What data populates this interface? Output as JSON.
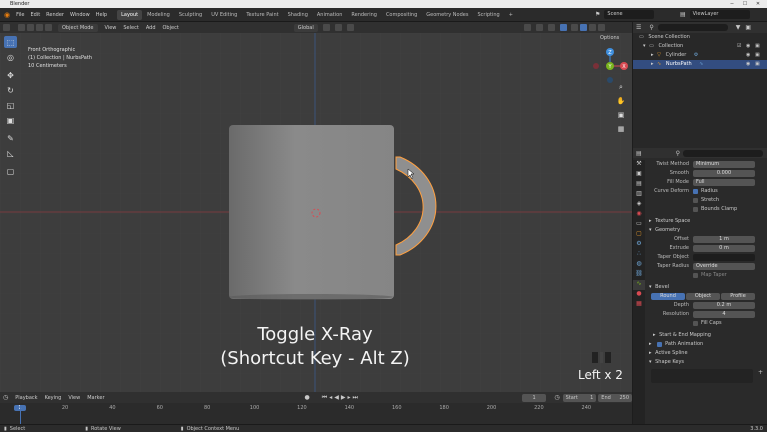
{
  "window": {
    "title": "Blender",
    "minimize": "─",
    "maximize": "☐",
    "close": "✕"
  },
  "menus": [
    "File",
    "Edit",
    "Render",
    "Window",
    "Help"
  ],
  "workspaces": [
    "Layout",
    "Modeling",
    "Sculpting",
    "UV Editing",
    "Texture Paint",
    "Shading",
    "Animation",
    "Rendering",
    "Compositing",
    "Geometry Nodes",
    "Scripting",
    "+"
  ],
  "active_workspace": "Layout",
  "scene": {
    "name": "Scene",
    "view_layer": "ViewLayer"
  },
  "viewport_header": {
    "mode": "Object Mode",
    "menus": [
      "View",
      "Select",
      "Add",
      "Object"
    ],
    "orientation": "Global",
    "options": "Options"
  },
  "viewport_info": {
    "line1": "Front Orthographic",
    "line2": "(1) Collection | NurbsPath",
    "line3": "10 Centimeters"
  },
  "gizmo": {
    "x": "X",
    "y": "Y",
    "z": "Z"
  },
  "overlay_caption": {
    "line1": "Toggle X-Ray",
    "line2": "(Shortcut Key - Alt Z)"
  },
  "key_hint": "Left x 2",
  "outliner": {
    "search_placeholder": "",
    "items": [
      {
        "label": "Scene Collection",
        "indent": 0
      },
      {
        "label": "Collection",
        "indent": 1
      },
      {
        "label": "Cylinder",
        "indent": 2
      },
      {
        "label": "NurbsPath",
        "indent": 2,
        "selected": true
      }
    ]
  },
  "properties": {
    "twist_method_label": "Twist Method",
    "twist_method_value": "Minimum",
    "smooth_label": "Smooth",
    "smooth_value": "0.000",
    "fill_mode_label": "Fill Mode",
    "fill_mode_value": "Full",
    "curve_deform_label": "Curve Deform",
    "radius_label": "Radius",
    "stretch_label": "Stretch",
    "bounds_clamp_label": "Bounds Clamp",
    "texture_space": "Texture Space",
    "geometry": "Geometry",
    "offset_label": "Offset",
    "offset_value": "1 m",
    "extrude_label": "Extrude",
    "extrude_value": "0 m",
    "taper_object_label": "Taper Object",
    "taper_radius_label": "Taper Radius",
    "taper_radius_value": "Override",
    "map_taper_label": "Map Taper",
    "bevel": "Bevel",
    "bevel_tabs": [
      "Round",
      "Object",
      "Profile"
    ],
    "depth_label": "Depth",
    "depth_value": "0.2 m",
    "resolution_label": "Resolution",
    "resolution_value": "4",
    "fill_caps_label": "Fill Caps",
    "start_end_mapping": "Start & End Mapping",
    "path_animation": "Path Animation",
    "active_spline": "Active Spline",
    "shape_keys": "Shape Keys"
  },
  "timeline": {
    "menus": [
      "Playback",
      "Keying",
      "View",
      "Marker"
    ],
    "current_frame": "1",
    "start_label": "Start",
    "start_value": "1",
    "end_label": "End",
    "end_value": "250",
    "ticks": [
      "1",
      "10",
      "20",
      "30",
      "40",
      "50",
      "60",
      "70",
      "80",
      "90",
      "100",
      "110",
      "120",
      "130",
      "140",
      "150",
      "160",
      "170",
      "180",
      "190",
      "200",
      "210",
      "220",
      "230",
      "240",
      "250"
    ]
  },
  "statusbar": {
    "select": "Select",
    "rotate_view": "Rotate View",
    "context_menu": "Object Context Menu",
    "version": "3.3.0"
  },
  "colors": {
    "accent": "#4772b3",
    "selection_outline": "#ffa040",
    "viewport_bg": "#3d3d3d",
    "axis_x": "#d94a52",
    "axis_y": "#7ab51e",
    "axis_z": "#3f8fde"
  }
}
